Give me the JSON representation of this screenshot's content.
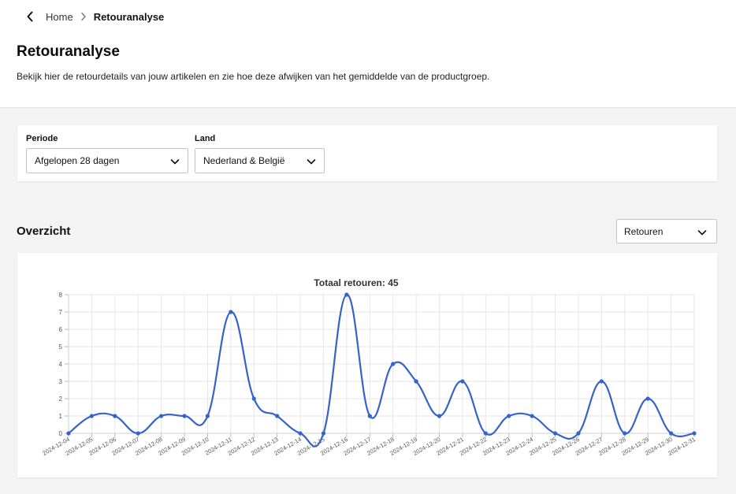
{
  "breadcrumb": {
    "home": "Home",
    "current": "Retouranalyse"
  },
  "page": {
    "title": "Retouranalyse",
    "description": "Bekijk hier de retourdetails van jouw artikelen en zie hoe deze afwijken van het gemiddelde van de productgroep."
  },
  "filters": {
    "period_label": "Periode",
    "period_value": "Afgelopen 28 dagen",
    "country_label": "Land",
    "country_value": "Nederland & België"
  },
  "overview": {
    "title": "Overzicht",
    "metric_value": "Retouren"
  },
  "colors": {
    "line": "#3563c9",
    "grid": "#e6e6e6"
  },
  "chart_data": {
    "type": "line",
    "title": "Totaal retouren: 45",
    "x": [
      "2024-12-04",
      "2024-12-05",
      "2024-12-06",
      "2024-12-07",
      "2024-12-08",
      "2024-12-09",
      "2024-12-10",
      "2024-12-11",
      "2024-12-12",
      "2024-12-13",
      "2024-12-14",
      "2024-12-15",
      "2024-12-16",
      "2024-12-17",
      "2024-12-18",
      "2024-12-19",
      "2024-12-20",
      "2024-12-21",
      "2024-12-22",
      "2024-12-23",
      "2024-12-24",
      "2024-12-25",
      "2024-12-26",
      "2024-12-27",
      "2024-12-28",
      "2024-12-29",
      "2024-12-30",
      "2024-12-31"
    ],
    "values": [
      0,
      1,
      1,
      0,
      1,
      1,
      1,
      7,
      2,
      1,
      0,
      0,
      8,
      1,
      4,
      3,
      1,
      3,
      0,
      1,
      1,
      0,
      0,
      3,
      0,
      2,
      0,
      0
    ],
    "ylim": [
      0,
      8
    ],
    "yticks": [
      0,
      1,
      2,
      3,
      4,
      5,
      6,
      7,
      8
    ],
    "grid": true
  }
}
